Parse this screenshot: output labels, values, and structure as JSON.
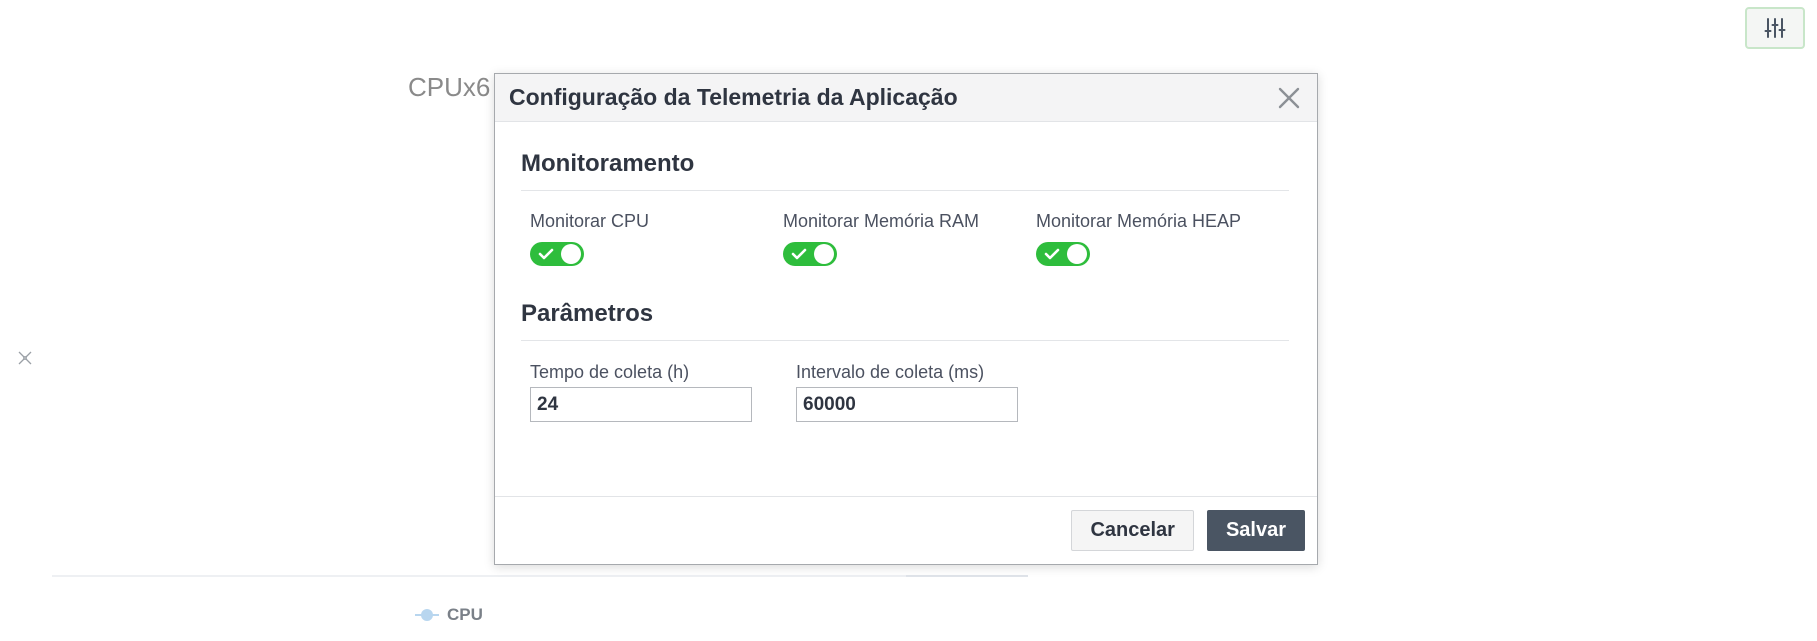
{
  "background": {
    "chart_title": "CPUx6",
    "legend_label": "CPU"
  },
  "modal": {
    "title": "Configuração da Telemetria da Aplicação",
    "monitoring": {
      "heading": "Monitoramento",
      "toggles": [
        {
          "label": "Monitorar CPU",
          "checked": true
        },
        {
          "label": "Monitorar Memória RAM",
          "checked": true
        },
        {
          "label": "Monitorar Memória HEAP",
          "checked": true
        }
      ]
    },
    "parameters": {
      "heading": "Parâmetros",
      "fields": [
        {
          "label": "Tempo de coleta (h)",
          "value": "24"
        },
        {
          "label": "Intervalo de coleta (ms)",
          "value": "60000"
        }
      ]
    },
    "footer": {
      "cancel_label": "Cancelar",
      "save_label": "Salvar"
    }
  },
  "colors": {
    "toggle_on": "#2ebd3c",
    "save_button": "#4a5563",
    "title_text": "#2f3541"
  },
  "icons": {
    "settings": "sliders-icon",
    "close": "close-icon",
    "toggle_check": "check-icon",
    "side": "collapse-icon"
  }
}
